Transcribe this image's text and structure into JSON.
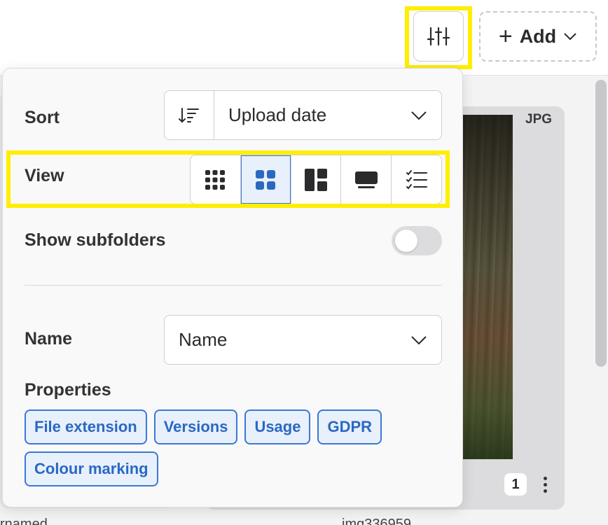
{
  "toolbar": {
    "add_label": "Add"
  },
  "background": {
    "file_extension_label": "JPG",
    "count_badge": "1",
    "bottom_name_left": "rnamed",
    "bottom_name_right": "img336959"
  },
  "panel": {
    "sort": {
      "label": "Sort",
      "selected": "Upload date"
    },
    "view": {
      "label": "View",
      "options": [
        {
          "icon": "small-grid-icon",
          "active": false
        },
        {
          "icon": "large-grid-icon",
          "active": true
        },
        {
          "icon": "masonry-icon",
          "active": false
        },
        {
          "icon": "presentation-icon",
          "active": false
        },
        {
          "icon": "checklist-icon",
          "active": false
        }
      ]
    },
    "subfolders": {
      "label": "Show subfolders",
      "enabled": false
    },
    "name": {
      "label": "Name",
      "selected": "Name"
    },
    "properties": {
      "label": "Properties",
      "chips": [
        "File extension",
        "Versions",
        "Usage",
        "GDPR",
        "Colour marking"
      ]
    }
  },
  "colors": {
    "accent": "#3a79d6",
    "highlight": "#ffee00"
  }
}
